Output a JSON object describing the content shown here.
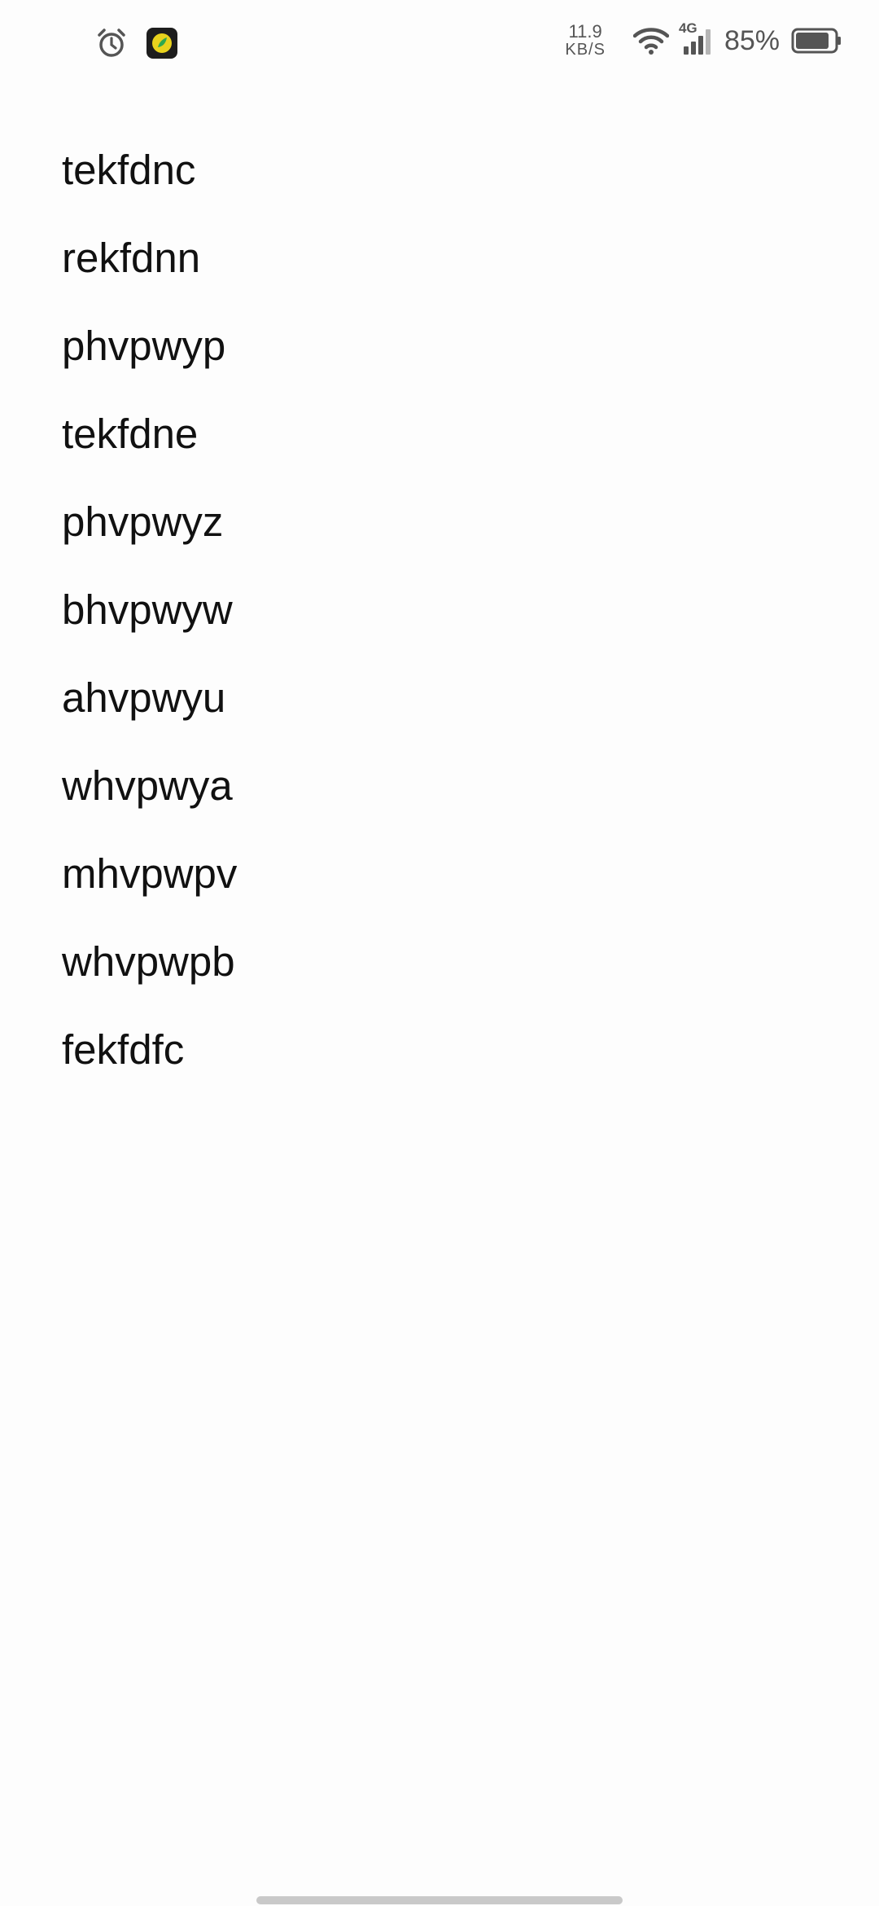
{
  "status_bar": {
    "net_speed_value": "11.9",
    "net_speed_unit": "KB/S",
    "network_type": "4G",
    "battery_percent": "85%",
    "icons": [
      "alarm-icon",
      "app-notification-icon",
      "wifi-icon",
      "signal-icon",
      "battery-icon"
    ]
  },
  "list": {
    "items": [
      "tekfdnc",
      "rekfdnn",
      "phvpwyp",
      "tekfdne",
      "phvpwyz",
      "bhvpwyw",
      "ahvpwyu",
      "whvpwya",
      "mhvpwpv",
      "whvpwpb",
      "fekfdfc"
    ]
  }
}
